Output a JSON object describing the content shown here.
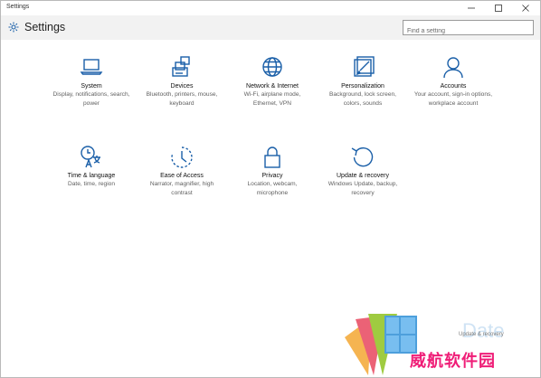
{
  "window": {
    "title": "Settings",
    "controls": [
      "minimize-icon",
      "maximize-icon",
      "close-icon"
    ]
  },
  "header": {
    "title": "Settings",
    "icon": "gear-icon"
  },
  "search": {
    "placeholder": "Find a setting"
  },
  "categories": [
    {
      "name": "System",
      "desc": "Display, notifications, search, power",
      "icon": "laptop-icon"
    },
    {
      "name": "Devices",
      "desc": "Bluetooth, printers, mouse, keyboard",
      "icon": "devices-icon"
    },
    {
      "name": "Network & Internet",
      "desc": "Wi-Fi, airplane mode, Ethernet, VPN",
      "icon": "globe-icon"
    },
    {
      "name": "Personalization",
      "desc": "Background, lock screen, colors, sounds",
      "icon": "paintbrush-icon"
    },
    {
      "name": "Accounts",
      "desc": "Your account, sign-in options, workplace account",
      "icon": "person-icon"
    },
    {
      "name": "Time & language",
      "desc": "Date, time, region",
      "icon": "time-language-icon"
    },
    {
      "name": "Ease of Access",
      "desc": "Narrator, magnifier, high contrast",
      "icon": "ease-of-access-icon"
    },
    {
      "name": "Privacy",
      "desc": "Location, webcam, microphone",
      "icon": "lock-icon"
    },
    {
      "name": "Update & recovery",
      "desc": "Windows Update, backup, recovery",
      "icon": "refresh-icon"
    }
  ],
  "watermark": {
    "text": "威航软件园",
    "ghost_text": "Update & recovery"
  },
  "colors": {
    "accent": "#1a5fa8",
    "header_bg": "#f2f2f2",
    "watermark_pink": "#ef1d77"
  }
}
